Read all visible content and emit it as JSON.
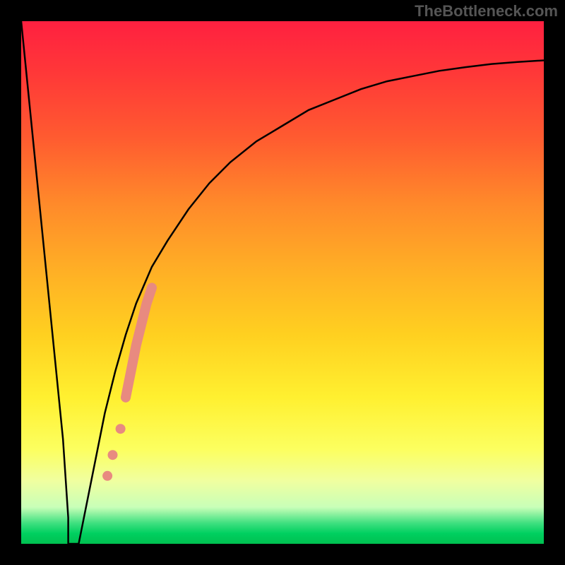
{
  "watermark": "TheBottleneck.com",
  "chart_data": {
    "type": "line",
    "title": "",
    "xlabel": "",
    "ylabel": "",
    "xlim": [
      0,
      100
    ],
    "ylim": [
      0,
      100
    ],
    "series": [
      {
        "name": "bottleneck-curve",
        "x": [
          0,
          2,
          4,
          6,
          8,
          9,
          10,
          11,
          12,
          14,
          16,
          18,
          20,
          22,
          25,
          28,
          32,
          36,
          40,
          45,
          50,
          55,
          60,
          65,
          70,
          75,
          80,
          85,
          90,
          95,
          100
        ],
        "values": [
          100,
          80,
          60,
          40,
          20,
          5,
          0,
          0,
          5,
          15,
          25,
          33,
          40,
          46,
          53,
          58,
          64,
          69,
          73,
          77,
          80,
          83,
          85,
          87,
          88.5,
          89.5,
          90.5,
          91.2,
          91.8,
          92.2,
          92.5
        ]
      }
    ],
    "flat_bottom": {
      "x_start": 9,
      "x_end": 11,
      "value": 0
    },
    "highlight_points": {
      "name": "marked-range",
      "color": "#e88a80",
      "points": [
        {
          "x": 16.5,
          "y": 13
        },
        {
          "x": 17.5,
          "y": 17
        },
        {
          "x": 19.0,
          "y": 22
        },
        {
          "x": 20.0,
          "y": 28
        },
        {
          "x": 21.0,
          "y": 33
        },
        {
          "x": 22.0,
          "y": 38
        },
        {
          "x": 23.0,
          "y": 42
        },
        {
          "x": 24.0,
          "y": 46
        },
        {
          "x": 25.0,
          "y": 49
        }
      ]
    },
    "gradient_stops": [
      {
        "pos": 0,
        "color": "#ff2040"
      },
      {
        "pos": 50,
        "color": "#ffc820"
      },
      {
        "pos": 85,
        "color": "#f8ff70"
      },
      {
        "pos": 100,
        "color": "#00c050"
      }
    ]
  }
}
